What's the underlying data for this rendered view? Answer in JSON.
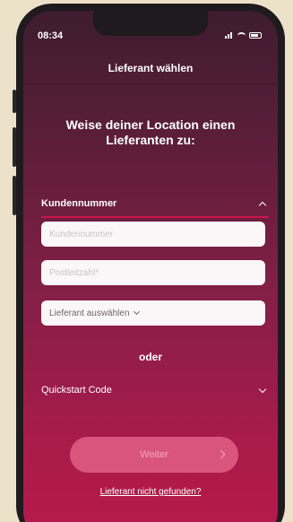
{
  "status_bar": {
    "time": "08:34"
  },
  "header": {
    "title": "Lieferant wählen"
  },
  "main": {
    "heading_line1": "Weise deiner Location einen",
    "heading_line2": "Lieferanten zu:",
    "section": {
      "label": "Kundennummer",
      "expanded": true,
      "icon": "chevron-up-icon"
    },
    "fields": [
      {
        "placeholder": "Kundennummer",
        "value": ""
      },
      {
        "placeholder": "Postleitzahl*",
        "value": ""
      }
    ],
    "supplier_select": {
      "label": "Lieferant auswählen",
      "icon": "chevron-down-icon"
    },
    "divider_text": "oder",
    "quickstart": {
      "label": "Quickstart Code",
      "expanded": false,
      "icon": "chevron-down-icon"
    },
    "next_button": {
      "label": "Weiter",
      "icon": "chevron-right-icon"
    },
    "not_found_link": "Lieferant nicht gefunden?"
  },
  "colors": {
    "accent": "#c8164a",
    "button_bg": "#d9557e",
    "gradient_top": "#3e1c2f",
    "gradient_bottom": "#b81a4c",
    "page_bg": "#ece1c9"
  }
}
